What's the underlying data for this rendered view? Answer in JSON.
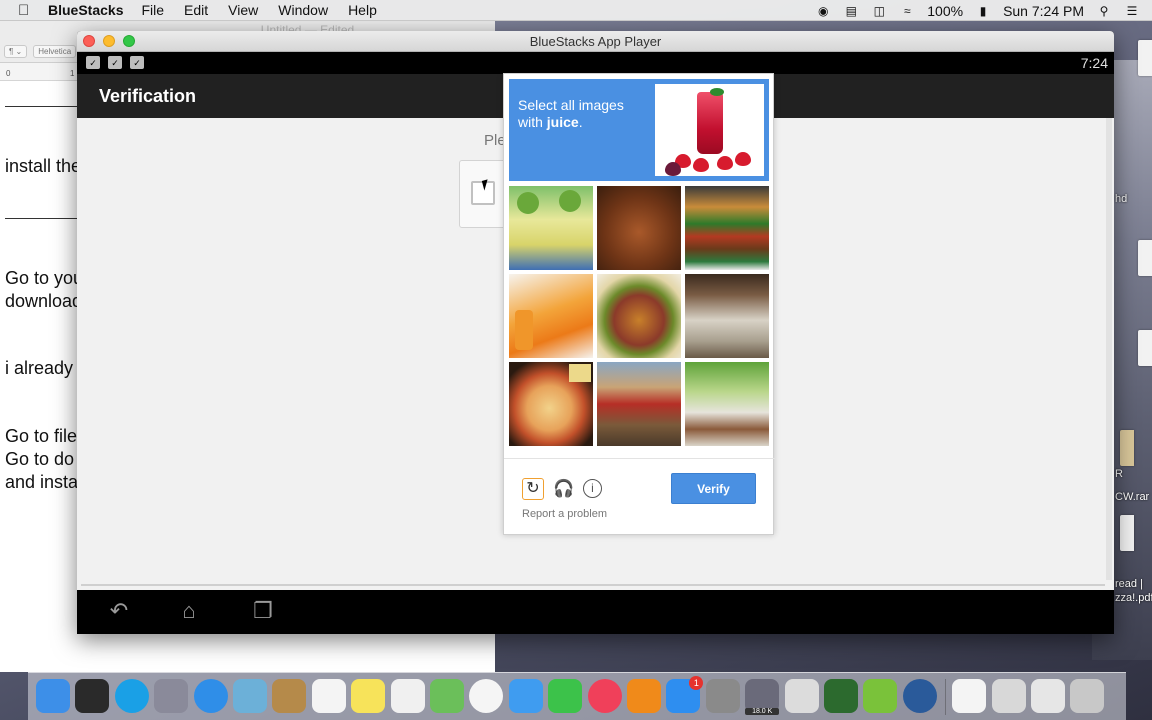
{
  "menubar": {
    "app_name": "BlueStacks",
    "items": [
      "File",
      "Edit",
      "View",
      "Window",
      "Help"
    ],
    "battery": "100%",
    "clock": "Sun 7:24 PM"
  },
  "textedit": {
    "title": "Untitled — Edited",
    "toolbar_style": "¶ ⌄",
    "toolbar_font": "Helvetica",
    "ruler_0": "0",
    "ruler_1": "1",
    "lines": [
      "install the",
      "Go to you",
      "download",
      "i already",
      "Go to file",
      "Go to do",
      "and insta"
    ]
  },
  "desktop_files": {
    "label_hd": "hd",
    "label_rar_r": "R",
    "label_rar": "CW.rar",
    "label_read": "read |",
    "label_pdf": "zza!.pdf"
  },
  "bluestacks": {
    "window_title": "BlueStacks App Player",
    "status_time": "7:24",
    "app_title": "Verification",
    "please_text": "Ple",
    "nav": {
      "back": "back-icon",
      "home": "home-icon",
      "recents": "recents-icon"
    }
  },
  "captcha": {
    "prompt_line1": "Select all images",
    "prompt_with": "with",
    "prompt_keyword": "juice",
    "prompt_end": ".",
    "verify_label": "Verify",
    "report_label": "Report a problem",
    "header_color": "#4a90e2",
    "tiles": [
      "kiwi juice glasses",
      "roast meat",
      "burger",
      "carrot juice",
      "sandwich",
      "buffet table",
      "pizza",
      "fruit market",
      "buffet dishes"
    ]
  },
  "dock": {
    "items": [
      "finder-icon",
      "launchpad-equalizer-icon",
      "skype-icon",
      "rocket-icon",
      "safari-icon",
      "preview-icon",
      "contacts-icon",
      "calendar-icon",
      "notes-icon",
      "reminders-icon",
      "maps-icon",
      "photos-icon",
      "messages-icon",
      "facetime-icon",
      "itunes-icon",
      "ibooks-icon",
      "app-store-icon",
      "system-preferences-icon",
      "network-icon",
      "bittorrent-icon",
      "bluestacks-dock-icon",
      "layers-icon",
      "quicktime-icon",
      "textedit-icon",
      "downloads-icon",
      "screenshot-icon",
      "trash-icon"
    ],
    "app_store_badge": "1",
    "network_label": "18.0 K"
  }
}
